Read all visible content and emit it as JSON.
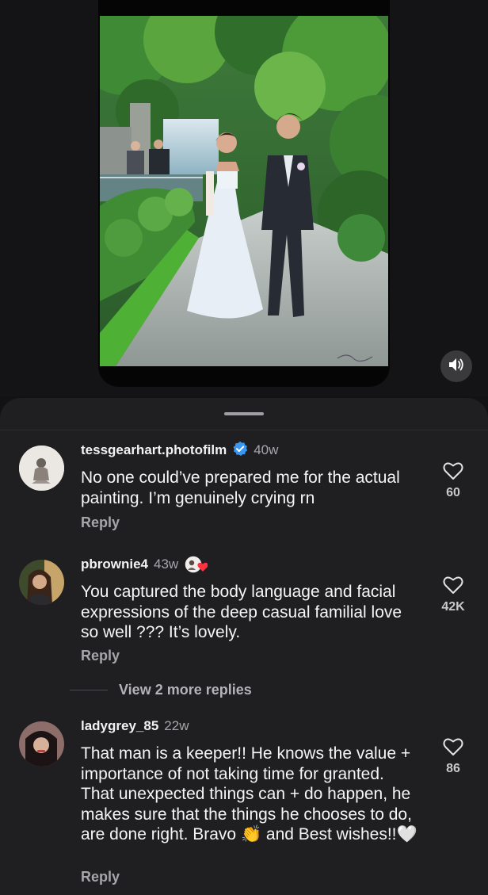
{
  "media": {
    "alt": "Painting of a couple walking in front of a waterfall",
    "mute_icon": "speaker-icon"
  },
  "comments": [
    {
      "username": "tessgearhart.photofilm",
      "verified": true,
      "time": "40w",
      "text": "No one could’ve prepared me for the actual painting. I’m genuinely crying rn",
      "reply_label": "Reply",
      "likes": "60"
    },
    {
      "username": "pbrownie4",
      "time": "43w",
      "creator_liked": true,
      "text": "You captured the body language and facial expressions of the deep casual familial love so well ??? It’s lovely.",
      "reply_label": "Reply",
      "likes": "42K",
      "view_replies_label": "View 2 more replies"
    },
    {
      "username": "ladygrey_85",
      "time": "22w",
      "text": "That man is a keeper!! He knows the value + importance of not taking time for granted. That unexpected things can + do happen, he makes sure that the things he chooses to do, are done right. Bravo 👏 and Best wishes!!🤍",
      "reply_label": "Reply",
      "likes": "86"
    }
  ],
  "colors": {
    "background": "#121214",
    "sheet": "#1f1f21",
    "muted_text": "#a6a6aa",
    "verified_badge": "#3897f0",
    "heart": "#ff3040"
  }
}
